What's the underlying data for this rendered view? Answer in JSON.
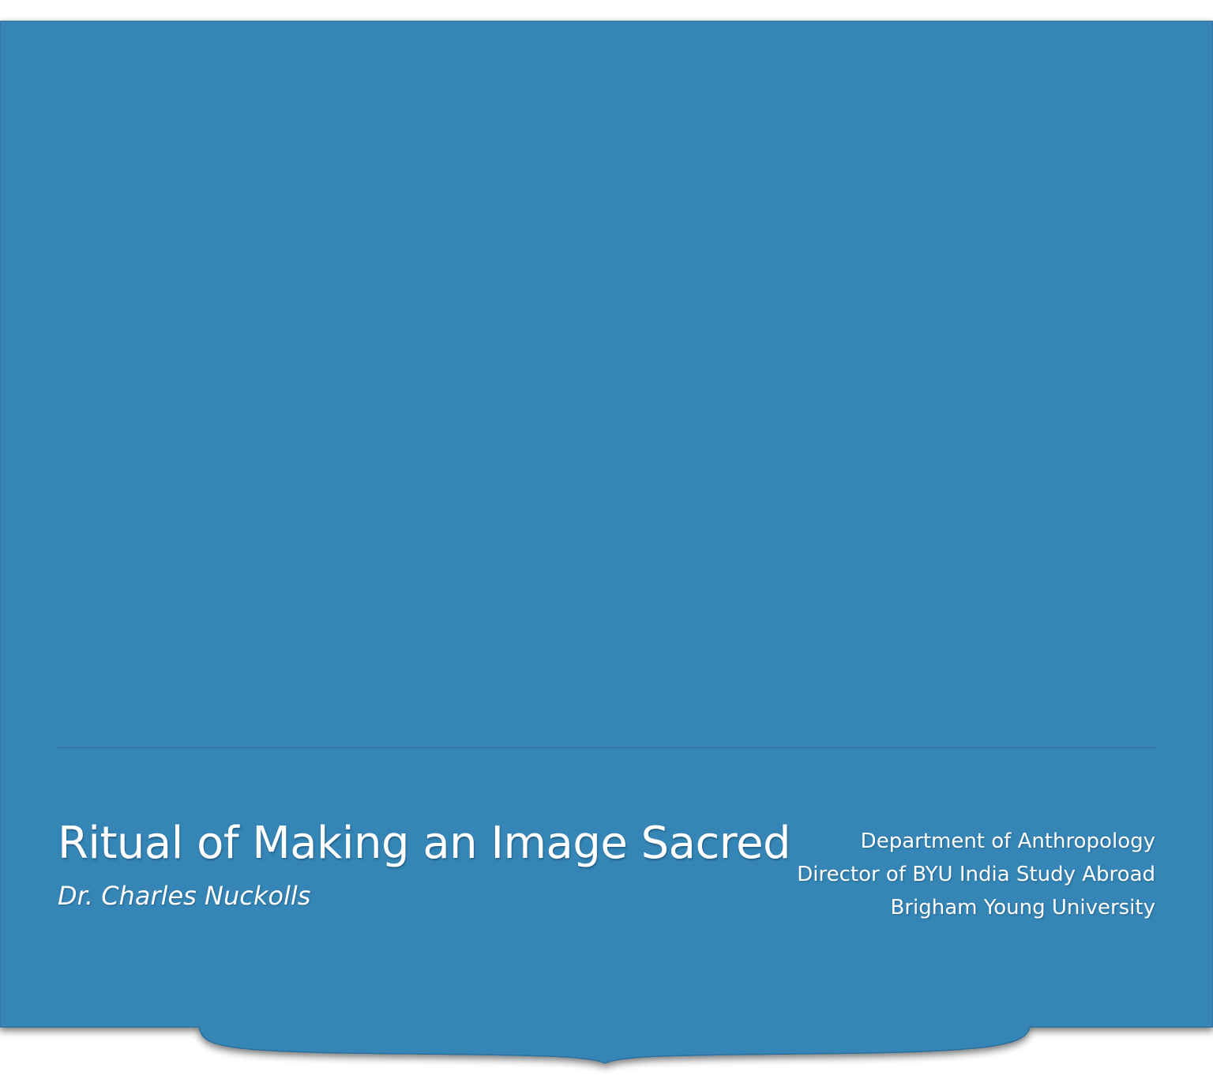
{
  "slide": {
    "title": "Ritual of Making an Image Sacred",
    "author": "Dr. Charles Nuckolls",
    "affiliation": [
      "Department of Anthropology",
      "Director of BYU India Study Abroad",
      "Brigham Young University"
    ]
  },
  "colors": {
    "background": "#ffffff",
    "banner": "#3686b6",
    "banner_edge": "#2d6f9a",
    "text": "#ffffff"
  }
}
